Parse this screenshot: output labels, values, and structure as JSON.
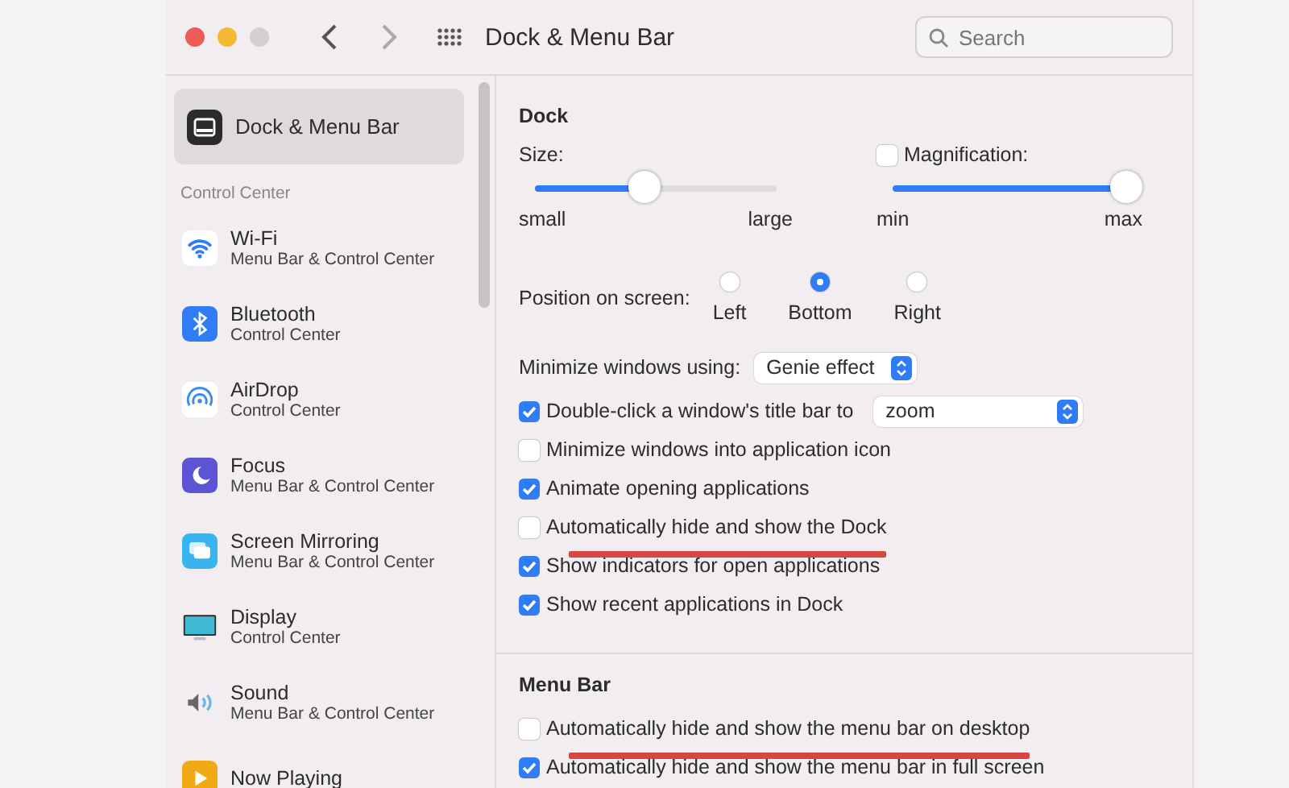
{
  "window": {
    "title": "Dock & Menu Bar"
  },
  "search": {
    "placeholder": "Search"
  },
  "sidebar": {
    "selected_item": {
      "label": "Dock & Menu Bar",
      "selected": true
    },
    "section": "Control Center",
    "items": [
      {
        "label": "Wi-Fi",
        "sublabel": "Menu Bar & Control Center",
        "kind": "wifi"
      },
      {
        "label": "Bluetooth",
        "sublabel": "Control Center",
        "kind": "bluetooth"
      },
      {
        "label": "AirDrop",
        "sublabel": "Control Center",
        "kind": "airdrop"
      },
      {
        "label": "Focus",
        "sublabel": "Menu Bar & Control Center",
        "kind": "focus"
      },
      {
        "label": "Screen Mirroring",
        "sublabel": "Menu Bar & Control Center",
        "kind": "mirroring"
      },
      {
        "label": "Display",
        "sublabel": "Control Center",
        "kind": "display"
      },
      {
        "label": "Sound",
        "sublabel": "Menu Bar & Control Center",
        "kind": "sound"
      },
      {
        "label": "Now Playing",
        "kind": "nowplaying"
      }
    ]
  },
  "dock": {
    "title": "Dock",
    "size": {
      "label": "Size:",
      "level": 0.45,
      "min_label": "small",
      "max_label": "large"
    },
    "magnification": {
      "label": "Magnification:",
      "checked": false,
      "level": 1,
      "min_label": "min",
      "max_label": "max"
    },
    "position": {
      "label": "Position on screen:",
      "options": [
        {
          "label": "Left",
          "selected": false
        },
        {
          "label": "Bottom",
          "selected": true
        },
        {
          "label": "Right",
          "selected": false
        }
      ]
    },
    "minimize": {
      "label": "Minimize windows using:",
      "value": "Genie effect"
    },
    "options": [
      {
        "kind": "checkbox-select",
        "label": "Double-click a window's title bar to",
        "checked": true,
        "value": "zoom",
        "annotated": false
      },
      {
        "kind": "checkbox",
        "label": "Minimize windows into application icon",
        "checked": false,
        "annotated": false
      },
      {
        "kind": "checkbox",
        "label": "Animate opening applications",
        "checked": true,
        "annotated": false
      },
      {
        "kind": "checkbox",
        "label": "Automatically hide and show the Dock",
        "checked": false,
        "annotated": true
      },
      {
        "kind": "checkbox",
        "label": "Show indicators for open applications",
        "checked": true,
        "annotated": false
      },
      {
        "kind": "checkbox",
        "label": "Show recent applications in Dock",
        "checked": true,
        "annotated": false
      }
    ]
  },
  "menu_bar": {
    "title": "Menu Bar",
    "options": [
      {
        "kind": "checkbox",
        "label": "Automatically hide and show the menu bar on desktop",
        "checked": false,
        "annotated": true
      },
      {
        "kind": "checkbox",
        "label": "Automatically hide and show the menu bar in full screen",
        "checked": true,
        "annotated": false
      }
    ]
  }
}
